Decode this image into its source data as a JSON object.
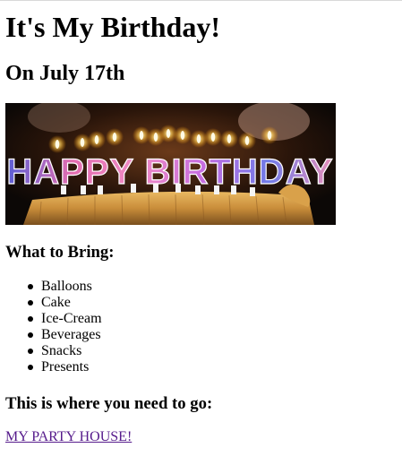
{
  "title": "It's My Birthday!",
  "subtitle": "On July 17th",
  "image": {
    "banner_text": "HAPPY BIRTHDAY"
  },
  "bring": {
    "heading": "What to Bring:",
    "items": [
      "Balloons",
      "Cake",
      "Ice-Cream",
      "Beverages",
      "Snacks",
      "Presents"
    ]
  },
  "directions": {
    "heading": "This is where you need to go:",
    "link_text": "MY PARTY HOUSE!"
  },
  "colors": {
    "link_visited": "#551a8b",
    "text": "#000000",
    "background": "#ffffff"
  }
}
